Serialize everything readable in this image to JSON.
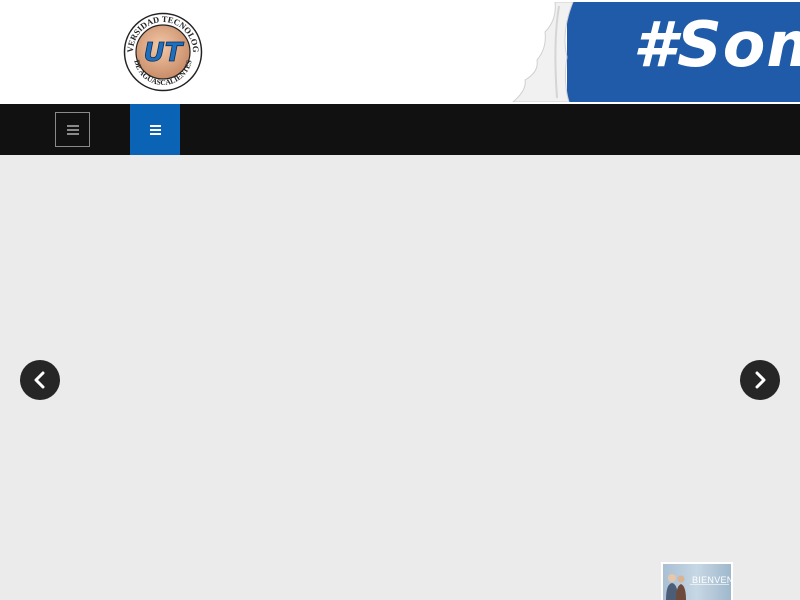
{
  "header": {
    "logo": {
      "ring_text_top": "UNIVERSIDAD TECNOLOGICA",
      "ring_text_bottom": "DE AGUASCALIENTES",
      "monogram": "UT"
    },
    "banner": {
      "text": "#Somo",
      "color": "#1f5ba8"
    }
  },
  "navbar": {
    "menu_toggle_icon": "hamburger-icon",
    "active_menu_icon": "bars-icon",
    "accent_color": "#0b63b6"
  },
  "slider": {
    "prev_icon": "chevron-left-icon",
    "next_icon": "chevron-right-icon",
    "thumbnail": {
      "caption": "BIENVEN"
    }
  }
}
